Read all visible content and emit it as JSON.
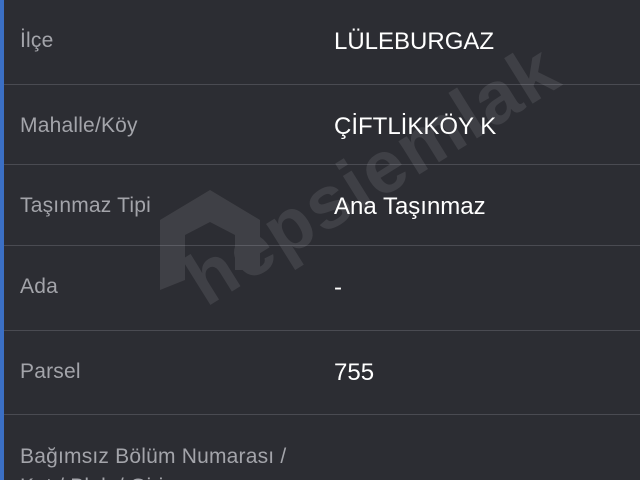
{
  "rows": [
    {
      "label": "İlçe",
      "value": "LÜLEBURGAZ"
    },
    {
      "label": "Mahalle/Köy",
      "value": "ÇİFTLİKKÖY K"
    },
    {
      "label": "Taşınmaz Tipi",
      "value": "Ana Taşınmaz"
    },
    {
      "label": "Ada",
      "value": "-"
    },
    {
      "label": "Parsel",
      "value": "755"
    },
    {
      "label": "Bağımsız Bölüm Numarası / Kat / Blok / Giriş"
    }
  ],
  "watermark": {
    "text": "hepsiemlak"
  },
  "colors": {
    "background": "#2c2d33",
    "accent": "#3b6fc4",
    "divider": "#4a4b52",
    "label": "#a3a4aa",
    "value": "#ffffff"
  }
}
